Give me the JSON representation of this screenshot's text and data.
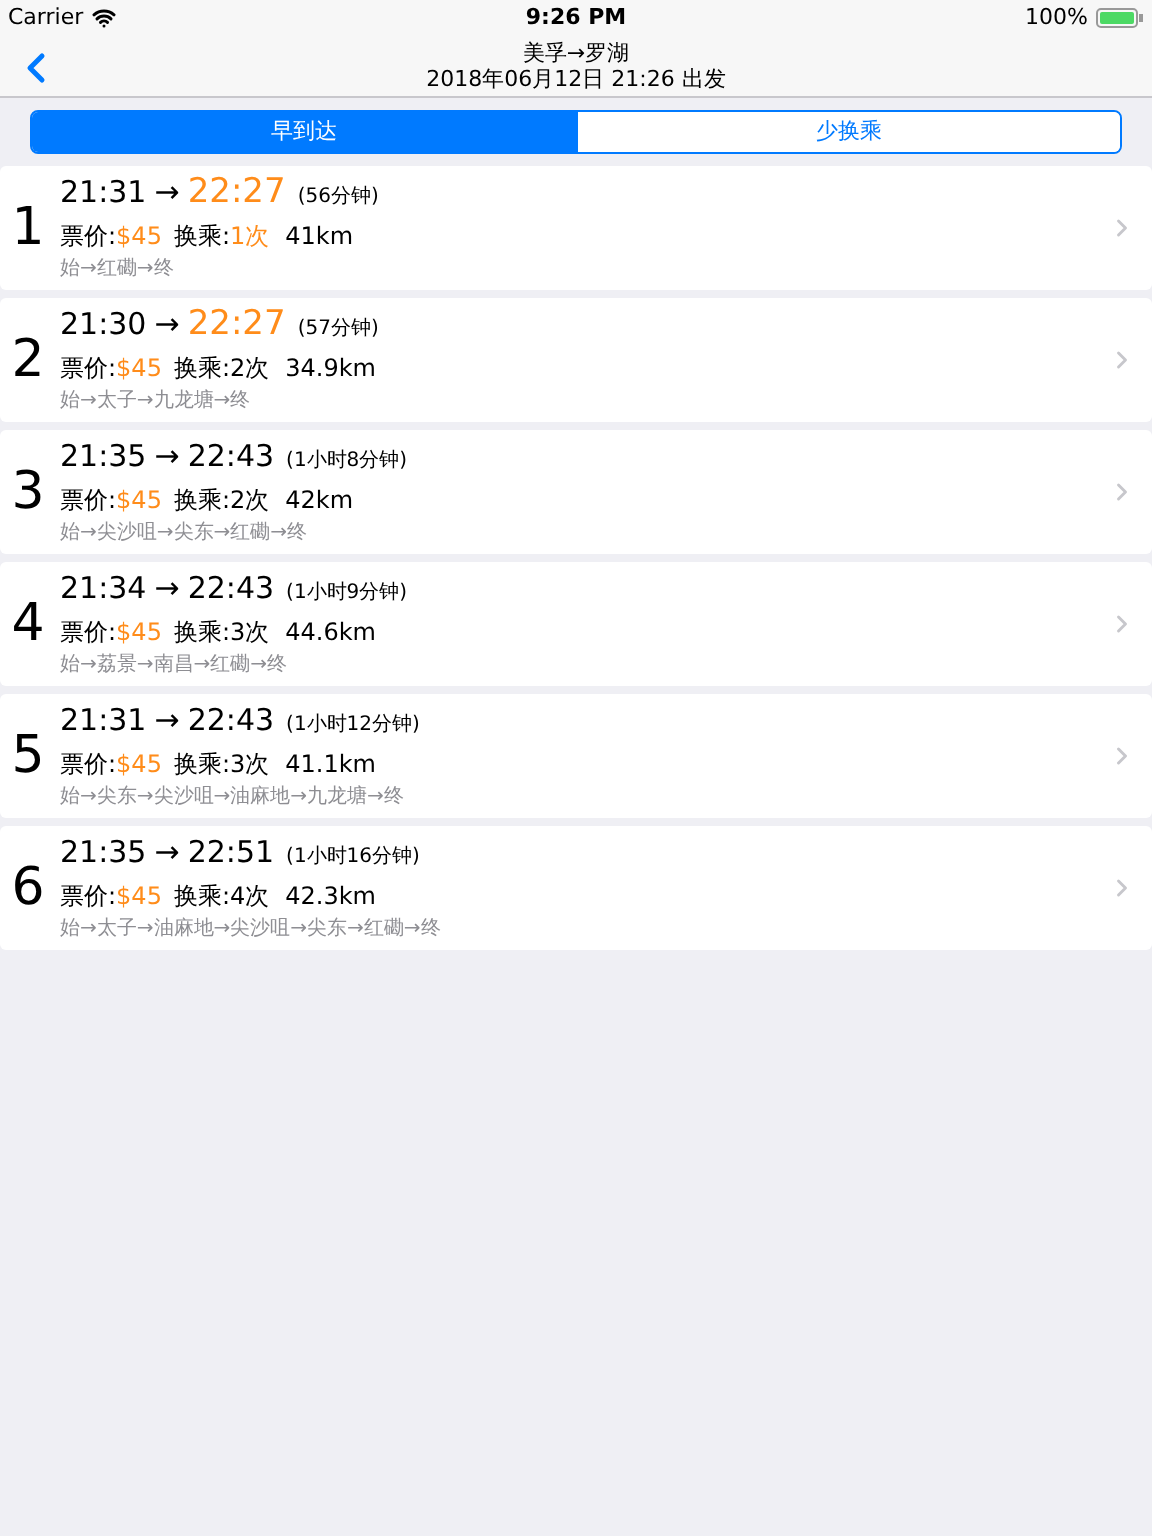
{
  "status_bar": {
    "carrier": "Carrier",
    "time": "9:26 PM",
    "battery": "100%"
  },
  "nav": {
    "title": "美孚→罗湖",
    "subtitle": "2018年06月12日 21:26 出发"
  },
  "segments": [
    {
      "label": "早到达",
      "selected": true
    },
    {
      "label": "少换乘",
      "selected": false
    }
  ],
  "routes": [
    {
      "index": "1",
      "depart": "21:31",
      "arrow": "→",
      "arrive": "22:27",
      "arrive_highlight": true,
      "duration": "(56分钟)",
      "price_label": "票价:",
      "price": "$45",
      "transfer_label": "换乘:",
      "transfers": "1次",
      "transfers_highlight": true,
      "distance": "41km",
      "path": "始→红磡→终"
    },
    {
      "index": "2",
      "depart": "21:30",
      "arrow": "→",
      "arrive": "22:27",
      "arrive_highlight": true,
      "duration": "(57分钟)",
      "price_label": "票价:",
      "price": "$45",
      "transfer_label": "换乘:",
      "transfers": "2次",
      "transfers_highlight": false,
      "distance": "34.9km",
      "path": "始→太子→九龙塘→终"
    },
    {
      "index": "3",
      "depart": "21:35",
      "arrow": "→",
      "arrive": "22:43",
      "arrive_highlight": false,
      "duration": "(1小时8分钟)",
      "price_label": "票价:",
      "price": "$45",
      "transfer_label": "换乘:",
      "transfers": "2次",
      "transfers_highlight": false,
      "distance": "42km",
      "path": "始→尖沙咀→尖东→红磡→终"
    },
    {
      "index": "4",
      "depart": "21:34",
      "arrow": "→",
      "arrive": "22:43",
      "arrive_highlight": false,
      "duration": "(1小时9分钟)",
      "price_label": "票价:",
      "price": "$45",
      "transfer_label": "换乘:",
      "transfers": "3次",
      "transfers_highlight": false,
      "distance": "44.6km",
      "path": "始→荔景→南昌→红磡→终"
    },
    {
      "index": "5",
      "depart": "21:31",
      "arrow": "→",
      "arrive": "22:43",
      "arrive_highlight": false,
      "duration": "(1小时12分钟)",
      "price_label": "票价:",
      "price": "$45",
      "transfer_label": "换乘:",
      "transfers": "3次",
      "transfers_highlight": false,
      "distance": "41.1km",
      "path": "始→尖东→尖沙咀→油麻地→九龙塘→终"
    },
    {
      "index": "6",
      "depart": "21:35",
      "arrow": "→",
      "arrive": "22:51",
      "arrive_highlight": false,
      "duration": "(1小时16分钟)",
      "price_label": "票价:",
      "price": "$45",
      "transfer_label": "换乘:",
      "transfers": "4次",
      "transfers_highlight": false,
      "distance": "42.3km",
      "path": "始→太子→油麻地→尖沙咀→尖东→红磡→终"
    }
  ]
}
